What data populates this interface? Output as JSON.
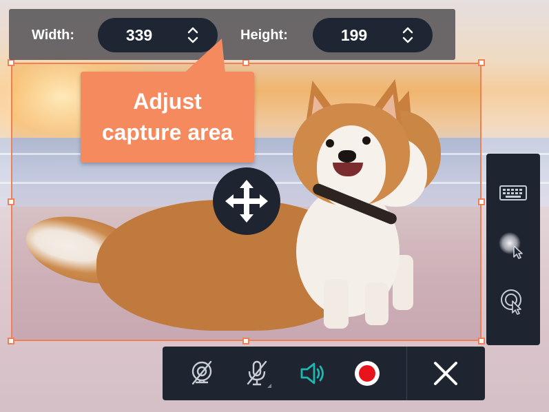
{
  "size_bar": {
    "width_label": "Width:",
    "width_value": "339",
    "height_label": "Height:",
    "height_value": "199"
  },
  "callout": {
    "line1": "Adjust",
    "line2": "capture area"
  },
  "colors": {
    "accent": "#f07f55",
    "panel": "#1f2431",
    "audio_on": "#1fb8b0",
    "record": "#e8141c"
  },
  "icons": {
    "move": "move-icon",
    "webcam": "webcam-off-icon",
    "mic": "microphone-off-icon",
    "speaker": "speaker-icon",
    "record": "record-icon",
    "close": "close-icon",
    "keystrokes": "keyboard-icon",
    "cursor_highlight": "cursor-highlight-icon",
    "click_effect": "cursor-click-icon"
  }
}
